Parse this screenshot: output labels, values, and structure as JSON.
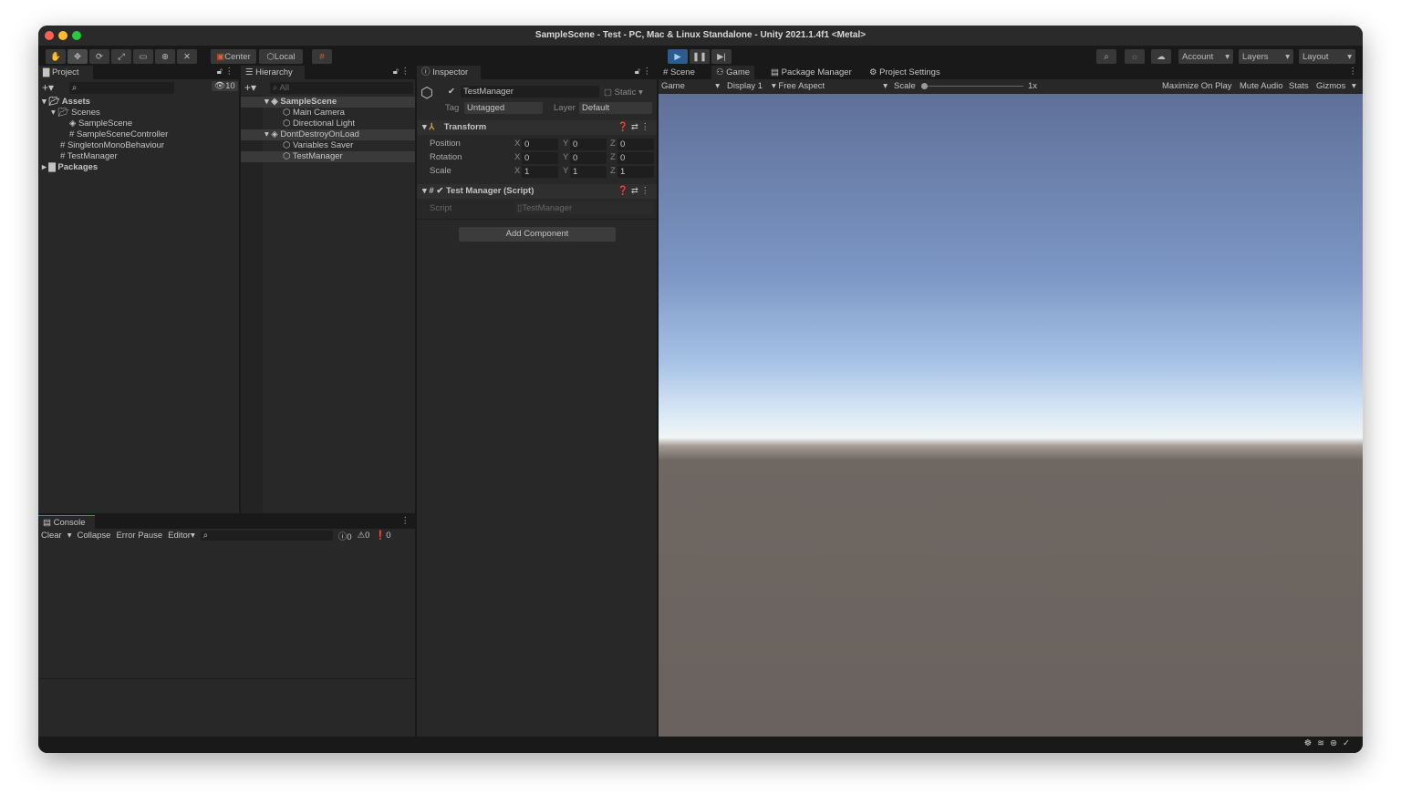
{
  "window": {
    "title": "SampleScene - Test - PC, Mac & Linux Standalone - Unity 2021.1.4f1 <Metal>"
  },
  "toolbar": {
    "center": "Center",
    "local": "Local",
    "account": "Account",
    "layers": "Layers",
    "layout": "Layout"
  },
  "project": {
    "tab": "Project",
    "hidden_count": "10",
    "items": [
      {
        "label": "Assets"
      },
      {
        "label": "Scenes"
      },
      {
        "label": "SampleScene"
      },
      {
        "label": "SampleSceneController"
      },
      {
        "label": "SingletonMonoBehaviour"
      },
      {
        "label": "TestManager"
      },
      {
        "label": "Packages"
      }
    ]
  },
  "hierarchy": {
    "tab": "Hierarchy",
    "search_placeholder": "All",
    "items": [
      {
        "label": "SampleScene"
      },
      {
        "label": "Main Camera"
      },
      {
        "label": "Directional Light"
      },
      {
        "label": "DontDestroyOnLoad"
      },
      {
        "label": "Variables Saver"
      },
      {
        "label": "TestManager"
      }
    ]
  },
  "console": {
    "tab": "Console",
    "clear": "Clear",
    "collapse": "Collapse",
    "error_pause": "Error Pause",
    "editor": "Editor",
    "info_count": "0",
    "warn_count": "0",
    "error_count": "0"
  },
  "inspector": {
    "tab": "Inspector",
    "object_name": "TestManager",
    "static": "Static",
    "tag_label": "Tag",
    "tag": "Untagged",
    "layer_label": "Layer",
    "layer": "Default",
    "transform": {
      "title": "Transform",
      "rows": [
        {
          "label": "Position",
          "x": "0",
          "y": "0",
          "z": "0"
        },
        {
          "label": "Rotation",
          "x": "0",
          "y": "0",
          "z": "0"
        },
        {
          "label": "Scale",
          "x": "1",
          "y": "1",
          "z": "1"
        }
      ]
    },
    "script_comp": {
      "title": "Test Manager (Script)",
      "script_label": "Script",
      "script_value": "TestManager"
    },
    "add_component": "Add Component"
  },
  "game": {
    "tabs": [
      "Scene",
      "Game",
      "Package Manager",
      "Project Settings"
    ],
    "display_mode": "Game",
    "display": "Display 1",
    "aspect": "Free Aspect",
    "scale_label": "Scale",
    "scale_value": "1x",
    "maximize": "Maximize On Play",
    "mute": "Mute Audio",
    "stats": "Stats",
    "gizmos": "Gizmos"
  },
  "axis": {
    "x": "X",
    "y": "Y",
    "z": "Z"
  }
}
